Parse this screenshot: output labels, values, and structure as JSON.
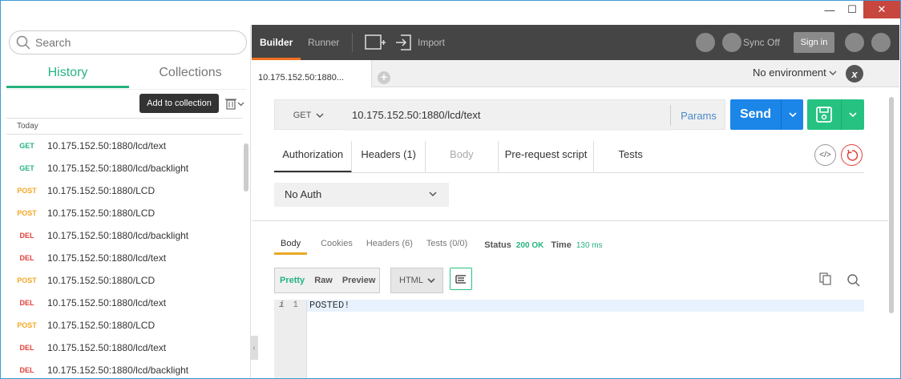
{
  "window": {
    "minimize": "—",
    "maximize": "☐",
    "close": "✕"
  },
  "sidebar": {
    "search_placeholder": "Search",
    "tabs": [
      {
        "label": "History",
        "active": true
      },
      {
        "label": "Collections",
        "active": false
      }
    ],
    "add_to_collection": "Add to collection",
    "group_label": "Today",
    "history": [
      {
        "method": "GET",
        "url": "10.175.152.50:1880/lcd/text"
      },
      {
        "method": "GET",
        "url": "10.175.152.50:1880/lcd/backlight"
      },
      {
        "method": "POST",
        "url": "10.175.152.50:1880/LCD"
      },
      {
        "method": "POST",
        "url": "10.175.152.50:1880/LCD"
      },
      {
        "method": "DEL",
        "url": "10.175.152.50:1880/lcd/backlight"
      },
      {
        "method": "DEL",
        "url": "10.175.152.50:1880/lcd/text"
      },
      {
        "method": "POST",
        "url": "10.175.152.50:1880/LCD"
      },
      {
        "method": "DEL",
        "url": "10.175.152.50:1880/lcd/text"
      },
      {
        "method": "POST",
        "url": "10.175.152.50:1880/LCD"
      },
      {
        "method": "DEL",
        "url": "10.175.152.50:1880/lcd/text"
      },
      {
        "method": "DEL",
        "url": "10.175.152.50:1880/lcd/backlight"
      }
    ]
  },
  "topbar": {
    "builder": "Builder",
    "runner": "Runner",
    "import": "Import",
    "sync": "Sync Off",
    "sign_in": "Sign in"
  },
  "request_tab": {
    "label": "10.175.152.50:1880..."
  },
  "environment": {
    "label": "No environment"
  },
  "request": {
    "method": "GET",
    "url": "10.175.152.50:1880/lcd/text",
    "params": "Params",
    "send": "Send"
  },
  "options_tabs": [
    {
      "label": "Authorization",
      "state": "active"
    },
    {
      "label": "Headers (1)",
      "state": "normal"
    },
    {
      "label": "Body",
      "state": "disabled"
    },
    {
      "label": "Pre-request script",
      "state": "normal"
    },
    {
      "label": "Tests",
      "state": "normal"
    }
  ],
  "auth": {
    "type": "No Auth"
  },
  "response": {
    "tabs": [
      "Body",
      "Cookies",
      "Headers (6)",
      "Tests (0/0)"
    ],
    "status_label": "Status",
    "status_value": "200 OK",
    "time_label": "Time",
    "time_value": "130 ms",
    "formats": [
      "Pretty",
      "Raw",
      "Preview"
    ],
    "language": "HTML",
    "gutter_marker": "i",
    "line_number": "1",
    "body_text": "POSTED!"
  }
}
